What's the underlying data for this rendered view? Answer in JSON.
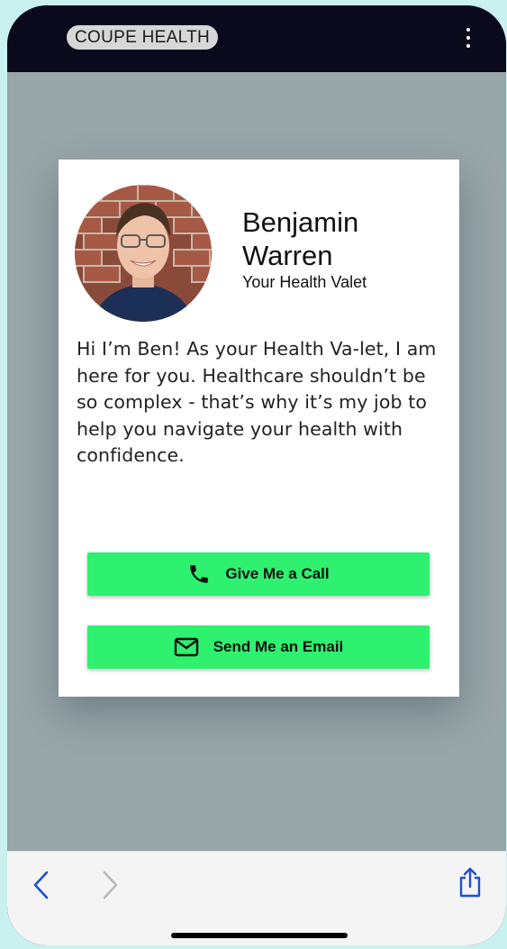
{
  "header": {
    "brand": "COUPE HEALTH",
    "menu_icon": "more-vertical-icon"
  },
  "profile": {
    "name": "Benjamin Warren",
    "role": "Your Health Valet",
    "bio": "Hi I’m Ben! As your Health Va-let, I am here for you. Healthcare shouldn’t be so complex - that’s why it’s my job to help you navigate your health with confidence."
  },
  "actions": {
    "call_label": "Give Me a Call",
    "call_icon": "phone-icon",
    "email_label": "Send Me an Email",
    "email_icon": "envelope-icon"
  },
  "browser": {
    "back_icon": "chevron-left-icon",
    "forward_icon": "chevron-right-icon",
    "share_icon": "share-icon"
  },
  "colors": {
    "button": "#2ef16f",
    "topbar": "#0b0a1c",
    "backdrop": "#98a5a9"
  }
}
